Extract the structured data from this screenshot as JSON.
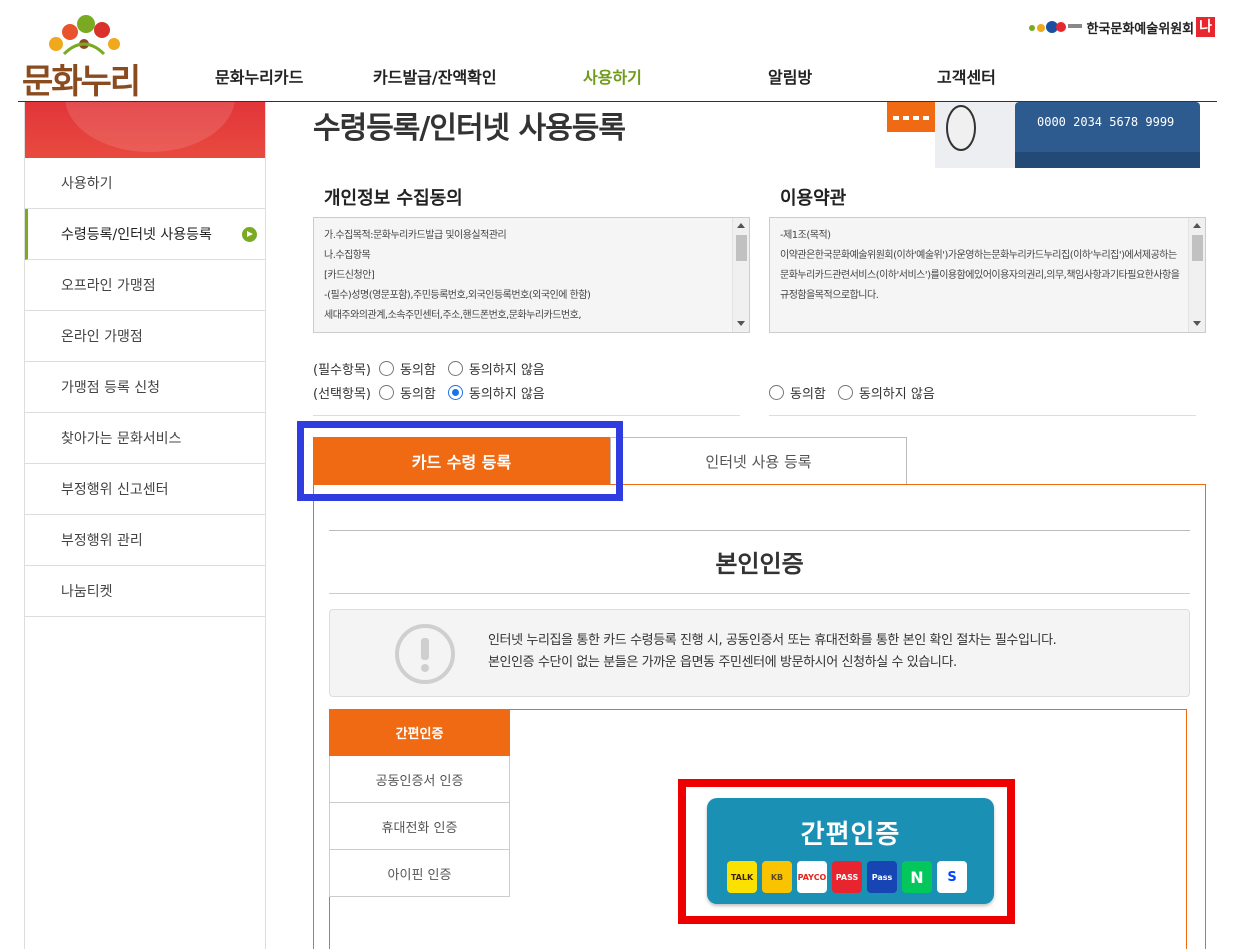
{
  "header": {
    "logo_text": "문화누리",
    "nav": [
      "문화누리카드",
      "카드발급/잔액확인",
      "사용하기",
      "알림방",
      "고객센터"
    ],
    "org_name": "한국문화예술위원회",
    "org_badge": "나"
  },
  "sidebar": {
    "items": [
      {
        "label": "사용하기"
      },
      {
        "label": "수령등록/인터넷 사용등록"
      },
      {
        "label": "오프라인 가맹점"
      },
      {
        "label": "온라인 가맹점"
      },
      {
        "label": "가맹점 등록 신청"
      },
      {
        "label": "찾아가는 문화서비스"
      },
      {
        "label": "부정행위 신고센터"
      },
      {
        "label": "부정행위 관리"
      },
      {
        "label": "나눔티켓"
      }
    ]
  },
  "page": {
    "title": "수령등록/인터넷 사용등록",
    "card_number": "0000 2034 5678 9999"
  },
  "privacy": {
    "title": "개인정보 수집동의",
    "lines": [
      "가.수집목적:문화누리카드발급 및이용실적관리",
      "나.수집항목",
      "[카드신청안]",
      "-(필수)성명(영문포함),주민등록번호,외국인등록번호(외국인에 한함)",
      "세대주와의관계,소속주민센터,주소,핸드폰번호,문화누리카드번호,"
    ],
    "required_label": "(필수항목)",
    "optional_label": "(선택항목)",
    "agree": "동의함",
    "disagree": "동의하지 않음"
  },
  "terms": {
    "title": "이용약관",
    "lines": [
      "-제1조(목적)",
      "이약관은한국문화예술위원회(이하'예술위')가운영하는문화누리카드누리집(이하'누리집')에서제공하는",
      "문화누리카드관련서비스(이하'서비스')를이용함에있어이용자의권리,의무,책임사항과기타필요한사항을",
      "규정함을목적으로합니다."
    ],
    "agree": "동의함",
    "disagree": "동의하지 않음"
  },
  "tabs": {
    "card": "카드 수령 등록",
    "internet": "인터넷 사용 등록"
  },
  "cert": {
    "title": "본인인증",
    "notice_1": "인터넷 누리집을 통한 카드 수령등록 진행 시, 공동인증서 또는 휴대전화를 통한 본인 확인 절차는 필수입니다.",
    "notice_2": "본인인증 수단이 없는 분들은 가까운 읍면동 주민센터에 방문하시어 신청하실 수 있습니다.",
    "methods": [
      "간편인증",
      "공동인증서 인증",
      "휴대전화 인증",
      "아이핀 인증"
    ],
    "easy_button": "간편인증",
    "providers": [
      {
        "label": "TALK",
        "bg": "#fae100",
        "fg": "#3b1e1e"
      },
      {
        "label": "KB",
        "bg": "#f9c300",
        "fg": "#5a4a2a"
      },
      {
        "label": "PAYCO",
        "bg": "#ffffff",
        "fg": "#e5231b"
      },
      {
        "label": "PASS",
        "bg": "#e8242f",
        "fg": "#ffffff"
      },
      {
        "label": "Pass",
        "bg": "#1745b4",
        "fg": "#ffffff"
      },
      {
        "label": "N",
        "bg": "#03c75a",
        "fg": "#ffffff"
      },
      {
        "label": "S",
        "bg": "#ffffff",
        "fg": "#0046ff"
      }
    ]
  },
  "colors": {
    "accent_orange": "#ef6a12",
    "accent_green": "#7aaa22",
    "highlight_blue": "#2f3de0",
    "highlight_red": "#ef0000",
    "easy_auth_blue": "#1a90b4"
  }
}
